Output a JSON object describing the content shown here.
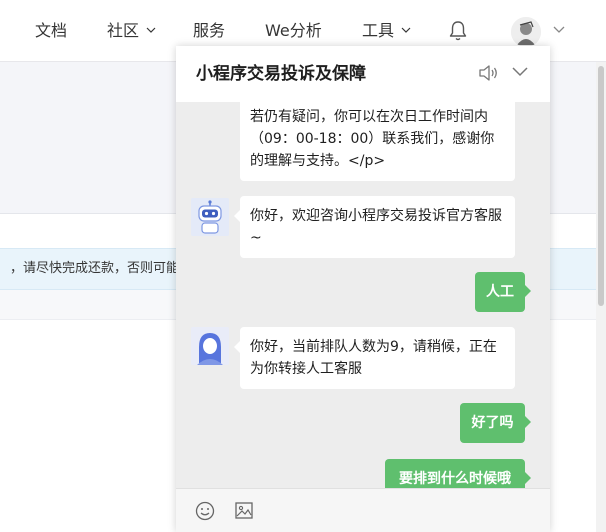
{
  "nav": {
    "items": [
      {
        "label": "文档",
        "dropdown": false
      },
      {
        "label": "社区",
        "dropdown": true
      },
      {
        "label": "服务",
        "dropdown": false
      },
      {
        "label": "We分析",
        "dropdown": false
      },
      {
        "label": "工具",
        "dropdown": true
      }
    ],
    "icons": [
      "bell-icon",
      "avatar",
      "chevron-down-icon"
    ]
  },
  "page": {
    "notice_text": "，请尽快完成还款，否则可能"
  },
  "chat": {
    "title": "小程序交易投诉及保障",
    "header_icons": [
      "speaker-icon",
      "chevron-down-icon"
    ],
    "messages": [
      {
        "side": "left",
        "avatar": "none",
        "text": "哦。\n若仍有疑问，你可以在次日工作时间内（09：00-18：00）联系我们，感谢你的理解与支持。</p>"
      },
      {
        "side": "left",
        "avatar": "robot-icon",
        "text": "你好，欢迎咨询小程序交易投诉官方客服~"
      },
      {
        "side": "right",
        "text": "人工"
      },
      {
        "side": "left",
        "avatar": "agent-icon",
        "text": "你好，当前排队人数为9，请稍候，正在为你转接人工客服"
      },
      {
        "side": "right",
        "text": "好了吗"
      },
      {
        "side": "right",
        "text": "要排到什么时候哦"
      }
    ],
    "footer_icons": [
      "emoji-icon",
      "image-icon"
    ],
    "colors": {
      "user_bubble": "#5fbf6e",
      "panel_bg": "#ededed",
      "bot_bubble": "#ffffff"
    }
  }
}
